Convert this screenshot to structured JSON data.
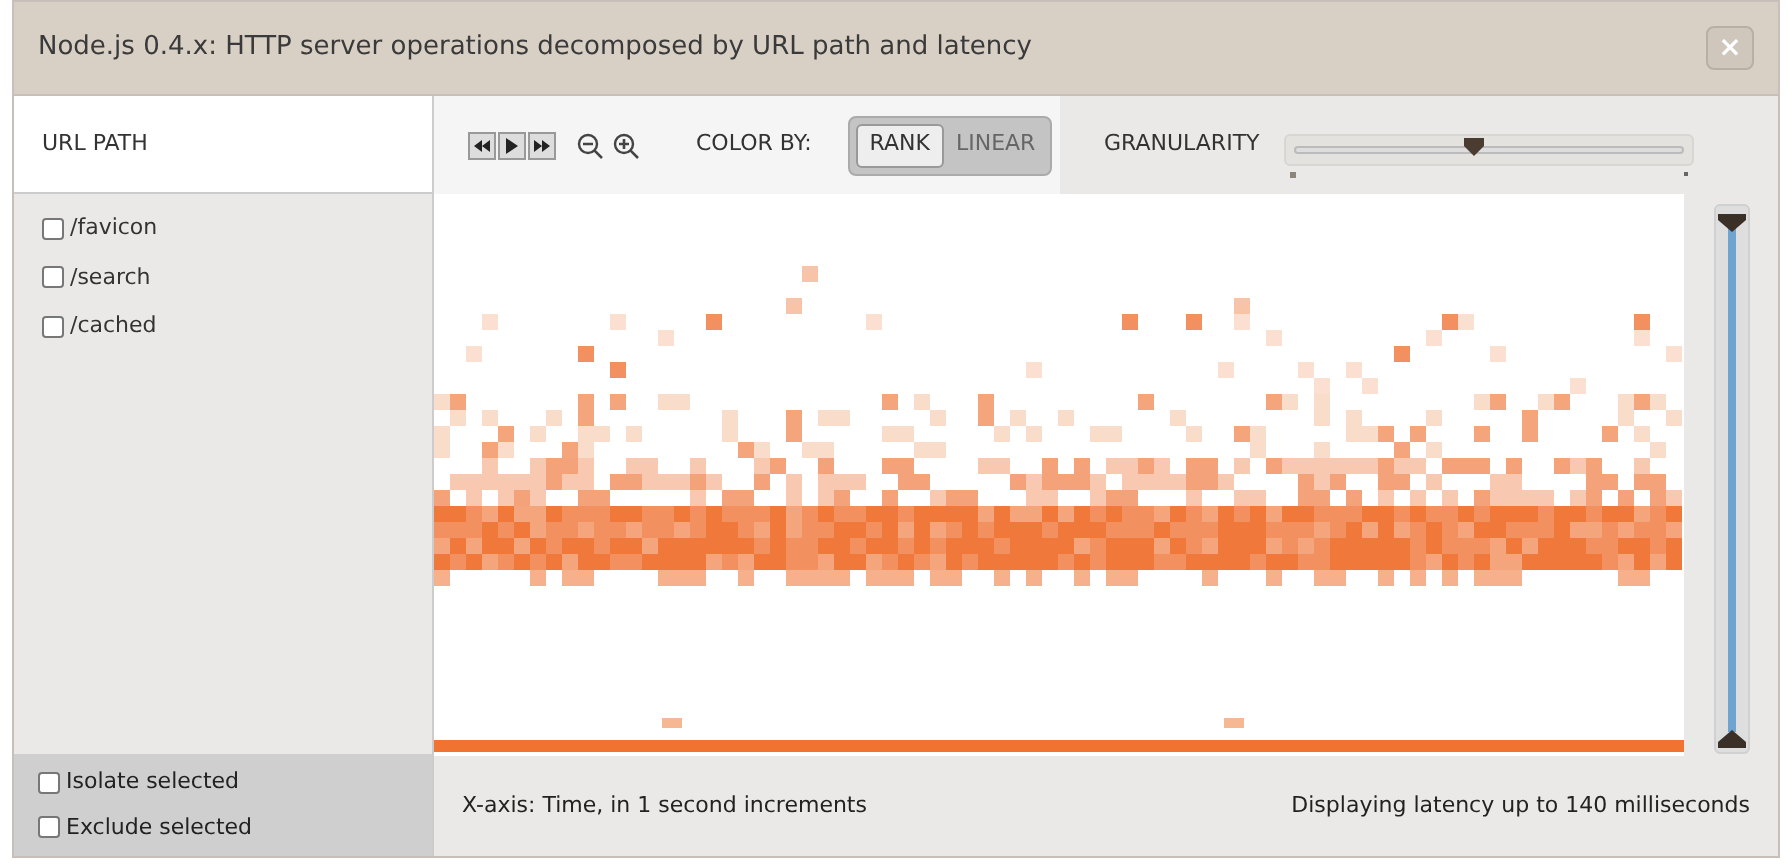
{
  "window": {
    "title": "Node.js 0.4.x: HTTP server operations decomposed by URL path and latency",
    "close": "×"
  },
  "sidebar": {
    "heading": "URL PATH",
    "items": [
      {
        "label": "/favicon",
        "checked": false
      },
      {
        "label": "/search",
        "checked": false
      },
      {
        "label": "/cached",
        "checked": false
      }
    ],
    "options": [
      {
        "label": "Isolate selected",
        "checked": false
      },
      {
        "label": "Exclude selected",
        "checked": false
      }
    ]
  },
  "toolbar": {
    "color_by_label": "COLOR BY:",
    "color_modes": [
      {
        "label": "RANK",
        "selected": true
      },
      {
        "label": "LINEAR",
        "selected": false
      }
    ],
    "granularity_label": "GRANULARITY",
    "granularity": {
      "level": 0.46
    },
    "latency_range": {
      "level": 1
    }
  },
  "footer": {
    "x_axis": "X-axis: Time, in 1 second increments",
    "latency": "Displaying latency up to 140 milliseconds"
  }
}
